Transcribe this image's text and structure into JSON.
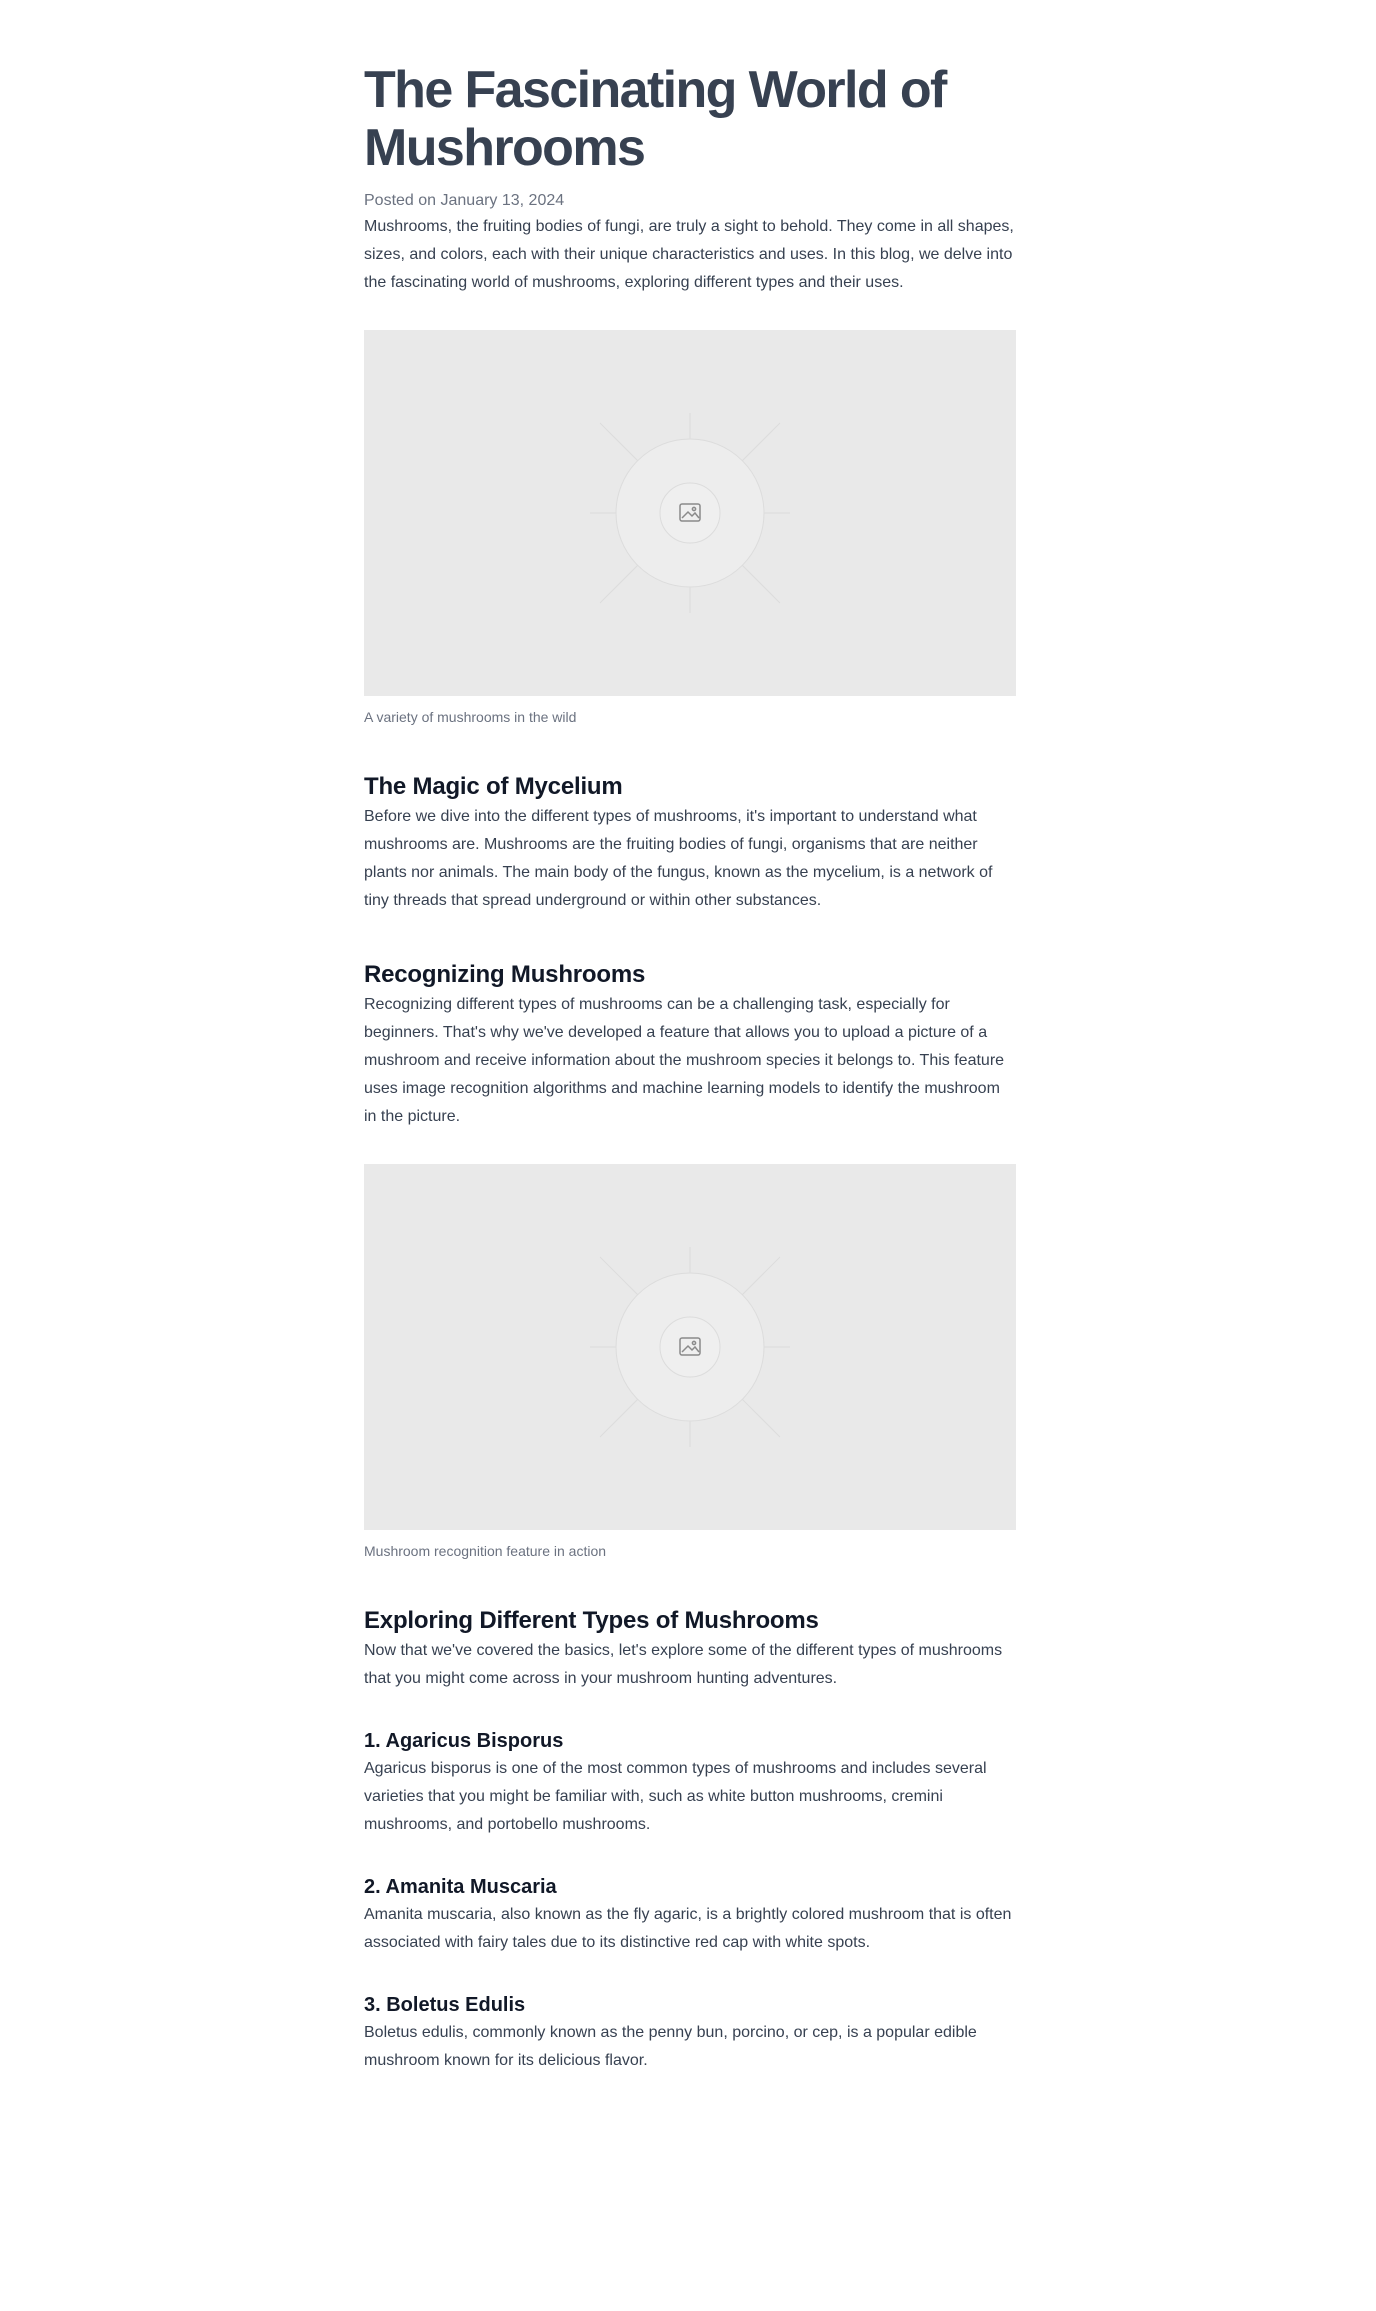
{
  "article": {
    "title": "The Fascinating World of Mushrooms",
    "date": "Posted on January 13, 2024",
    "intro": "Mushrooms, the fruiting bodies of fungi, are truly a sight to behold. They come in all shapes, sizes, and colors, each with their unique characteristics and uses. In this blog, we delve into the fascinating world of mushrooms, exploring different types and their uses.",
    "figure1": {
      "icon": "image-icon",
      "caption": "A variety of mushrooms in the wild"
    },
    "section1": {
      "heading": "The Magic of Mycelium",
      "text": "Before we dive into the different types of mushrooms, it's important to understand what mushrooms are. Mushrooms are the fruiting bodies of fungi, organisms that are neither plants nor animals. The main body of the fungus, known as the mycelium, is a network of tiny threads that spread underground or within other substances."
    },
    "section2": {
      "heading": "Recognizing Mushrooms",
      "text": "Recognizing different types of mushrooms can be a challenging task, especially for beginners. That's why we've developed a feature that allows you to upload a picture of a mushroom and receive information about the mushroom species it belongs to. This feature uses image recognition algorithms and machine learning models to identify the mushroom in the picture."
    },
    "figure2": {
      "icon": "image-icon",
      "caption": "Mushroom recognition feature in action"
    },
    "section3": {
      "heading": "Exploring Different Types of Mushrooms",
      "text": "Now that we've covered the basics, let's explore some of the different types of mushrooms that you might come across in your mushroom hunting adventures.",
      "types": [
        {
          "heading": "1. Agaricus Bisporus",
          "text": "Agaricus bisporus is one of the most common types of mushrooms and includes several varieties that you might be familiar with, such as white button mushrooms, cremini mushrooms, and portobello mushrooms."
        },
        {
          "heading": "2. Amanita Muscaria",
          "text": "Amanita muscaria, also known as the fly agaric, is a brightly colored mushroom that is often associated with fairy tales due to its distinctive red cap with white spots."
        },
        {
          "heading": "3. Boletus Edulis",
          "text": "Boletus edulis, commonly known as the penny bun, porcino, or cep, is a popular edible mushroom known for its delicious flavor."
        }
      ]
    }
  },
  "colors": {
    "title": "#374151",
    "heading": "#111827",
    "body": "#374151",
    "muted": "#6b7280",
    "placeholder_bg": "#e9e9e9"
  }
}
